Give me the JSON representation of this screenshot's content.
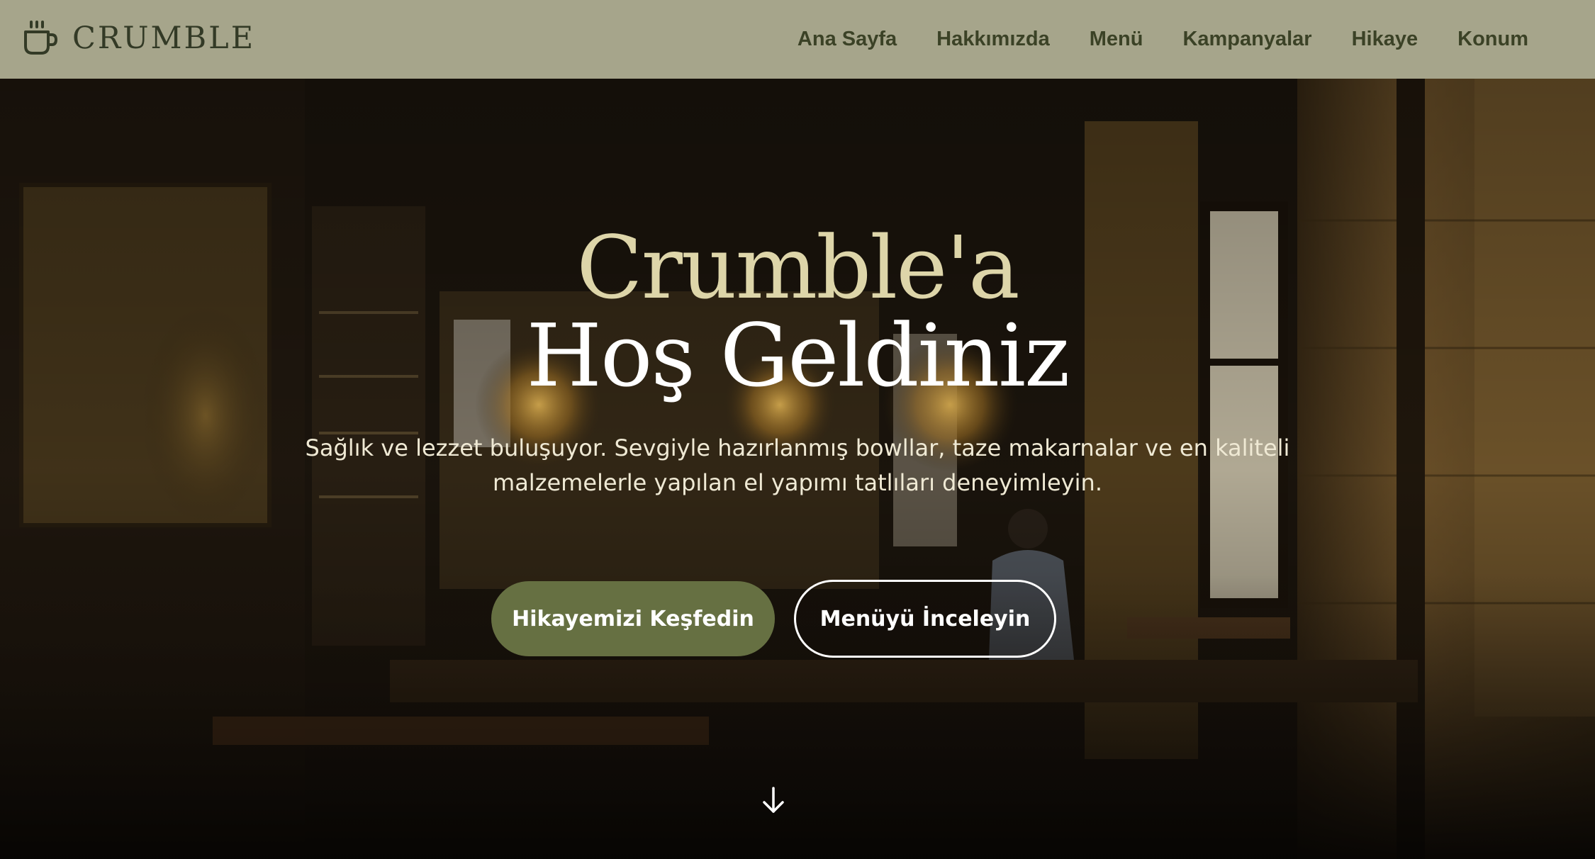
{
  "brand": {
    "name": "CRUMBLE",
    "icon": "coffee-cup-icon"
  },
  "nav": {
    "items": [
      {
        "label": "Ana Sayfa"
      },
      {
        "label": "Hakkımızda"
      },
      {
        "label": "Menü"
      },
      {
        "label": "Kampanyalar"
      },
      {
        "label": "Hikaye"
      },
      {
        "label": "Konum"
      }
    ]
  },
  "hero": {
    "title_line_1": "Crumble'a",
    "title_line_2": "Hoş Geldiniz",
    "subtitle": "Sağlık ve lezzet buluşuyor. Sevgiyle hazırlanmış bowllar, taze makarnalar ve en kaliteli malzemelerle yapılan el yapımı tatlıları deneyimleyin.",
    "primary_button": "Hikayemizi Keşfedin",
    "secondary_button": "Menüyü İnceleyin",
    "scroll_icon": "arrow-down-icon"
  },
  "colors": {
    "navbar_bg": "#a6a58b",
    "brand_text": "#333a26",
    "title_accent": "#ddd5a9",
    "primary_button": "#667042",
    "text_light": "#ffffff"
  }
}
